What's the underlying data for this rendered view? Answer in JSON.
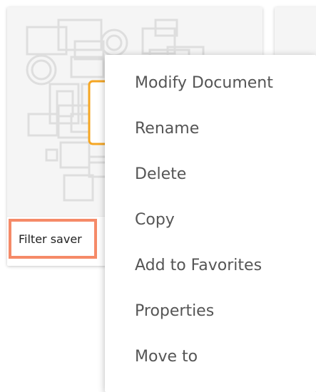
{
  "card": {
    "title": "Filter saver",
    "highlight_color": "#f58a68",
    "thumbnail_icon": "document-collage-thumbnail"
  },
  "adjacent_card": {
    "partial_text": "i"
  },
  "context_menu": {
    "items": [
      {
        "label": "Modify Document"
      },
      {
        "label": "Rename"
      },
      {
        "label": "Delete"
      },
      {
        "label": "Copy"
      },
      {
        "label": "Add to Favorites"
      },
      {
        "label": "Properties"
      },
      {
        "label": "Move to"
      }
    ]
  }
}
